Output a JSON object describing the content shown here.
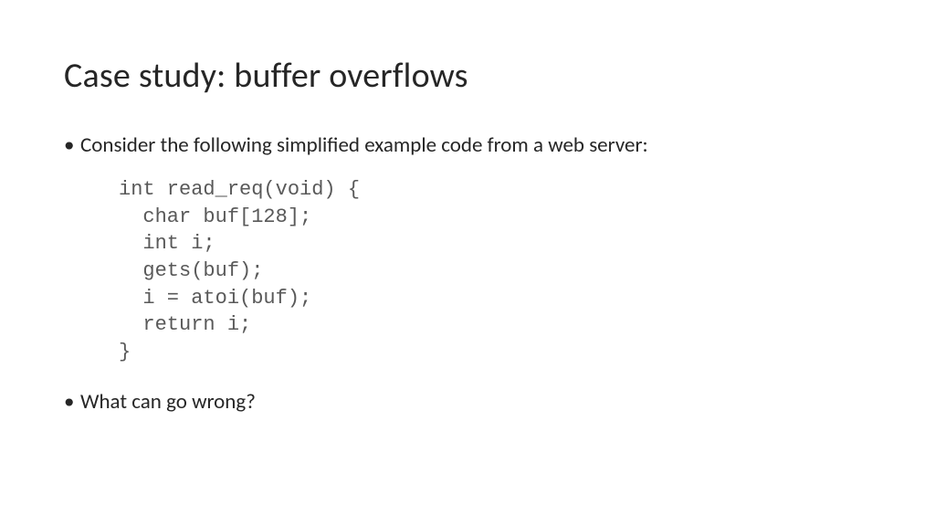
{
  "slide": {
    "title": "Case study: buffer overflows",
    "bullets": [
      "Consider the following simplified example code from a web server:",
      "What can go wrong?"
    ],
    "code": "int read_req(void) {\n  char buf[128];\n  int i;\n  gets(buf);\n  i = atoi(buf);\n  return i;\n}"
  }
}
